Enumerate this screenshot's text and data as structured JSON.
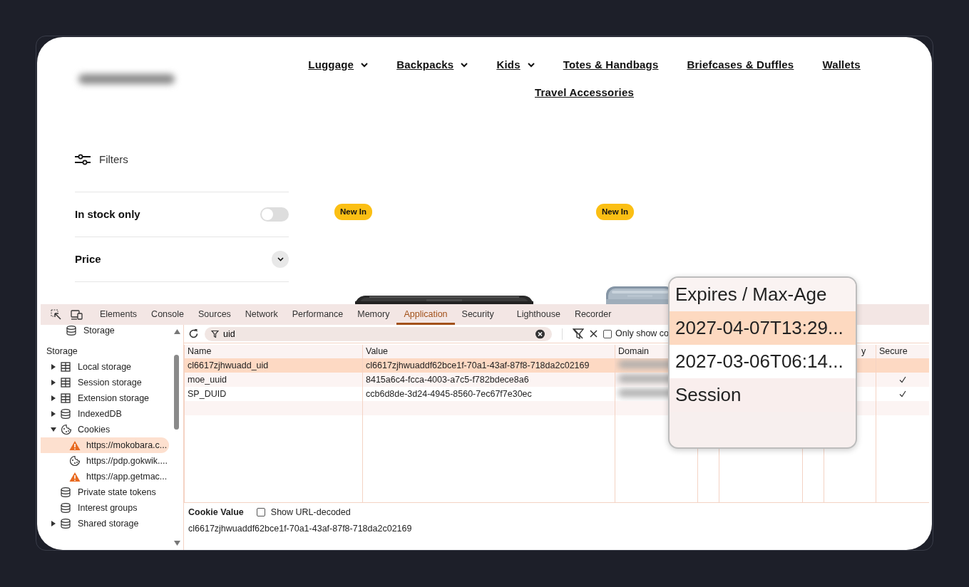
{
  "site": {
    "nav_rows": [
      [
        {
          "label": "Luggage",
          "dropdown": true
        },
        {
          "label": "Backpacks",
          "dropdown": true
        },
        {
          "label": "Kids",
          "dropdown": true
        },
        {
          "label": "Totes & Handbags",
          "dropdown": false
        },
        {
          "label": "Briefcases & Duffles",
          "dropdown": false
        },
        {
          "label": "Wallets",
          "dropdown": false
        }
      ],
      [
        {
          "label": "Travel Accessories",
          "dropdown": false
        }
      ]
    ],
    "filters_title": "Filters",
    "filters": [
      {
        "kind": "toggle",
        "label": "In stock only",
        "on": false
      },
      {
        "kind": "accordion",
        "label": "Price",
        "expanded": false
      }
    ],
    "products": [
      {
        "badge": "New In"
      },
      {
        "badge": "New In"
      }
    ]
  },
  "devtools": {
    "tabs": [
      {
        "label": "Elements",
        "selected": false
      },
      {
        "label": "Console",
        "selected": false
      },
      {
        "label": "Sources",
        "selected": false
      },
      {
        "label": "Network",
        "selected": false
      },
      {
        "label": "Performance",
        "selected": false
      },
      {
        "label": "Memory",
        "selected": false
      },
      {
        "label": "Application",
        "selected": true
      },
      {
        "label": "Security",
        "selected": false
      },
      {
        "label": "Lighthouse",
        "selected": false
      },
      {
        "label": "Recorder",
        "selected": false
      }
    ],
    "sidebar": {
      "top_item": {
        "label": "Storage",
        "kind": "database"
      },
      "section": "Storage",
      "tree": [
        {
          "label": "Local storage",
          "kind": "table",
          "expanded": false,
          "selected": false
        },
        {
          "label": "Session storage",
          "kind": "table",
          "expanded": false,
          "selected": false
        },
        {
          "label": "Extension storage",
          "kind": "table",
          "expanded": false,
          "selected": false
        },
        {
          "label": "IndexedDB",
          "kind": "database",
          "expanded": false,
          "selected": false
        },
        {
          "label": "Cookies",
          "kind": "cookie",
          "expanded": true,
          "selected": false,
          "children": [
            {
              "label": "https://mokobara.c...",
              "kind": "warning",
              "selected": true
            },
            {
              "label": "https://pdp.gokwik....",
              "kind": "cookie",
              "selected": false
            },
            {
              "label": "https://app.getmac...",
              "kind": "warning",
              "selected": false
            }
          ]
        },
        {
          "label": "Private state tokens",
          "kind": "database",
          "selected": false
        },
        {
          "label": "Interest groups",
          "kind": "database",
          "selected": false
        },
        {
          "label": "Shared storage",
          "kind": "database",
          "expanded": false,
          "selected": false
        }
      ]
    },
    "filter": {
      "value": "uid"
    },
    "only_show": {
      "label": "Only show co",
      "checked": false
    },
    "table": {
      "columns": [
        {
          "label": "Name"
        },
        {
          "label": "Value"
        },
        {
          "label": "Domain"
        },
        {
          "label": "y"
        },
        {
          "label": "Secure"
        }
      ],
      "rows": [
        {
          "name": "cl6617zjhwuadd_uid",
          "value": "cl6617zjhwuaddf62bce1f-70a1-43af-87f8-718da2c02169",
          "secure": false,
          "selected": true
        },
        {
          "name": "moe_uuid",
          "value": "8415a6c4-fcca-4003-a7c5-f782bdece8a6",
          "secure": true,
          "selected": false
        },
        {
          "name": "SP_DUID",
          "value": "ccb6d8de-3d24-4945-8560-7ec67f7e30ec",
          "secure": true,
          "selected": false
        }
      ]
    },
    "cookie_value": {
      "label": "Cookie Value",
      "decode_label": "Show URL-decoded",
      "decoded": false,
      "value": "cl6617zjhwuaddf62bce1f-70a1-43af-87f8-718da2c02169"
    }
  },
  "magnifier": {
    "header": "Expires / Max-Age",
    "rows": [
      {
        "text": "2027-04-07T13:29...",
        "selected": true
      },
      {
        "text": "2027-03-06T06:14...",
        "selected": false
      },
      {
        "text": "Session",
        "selected": false
      }
    ]
  }
}
